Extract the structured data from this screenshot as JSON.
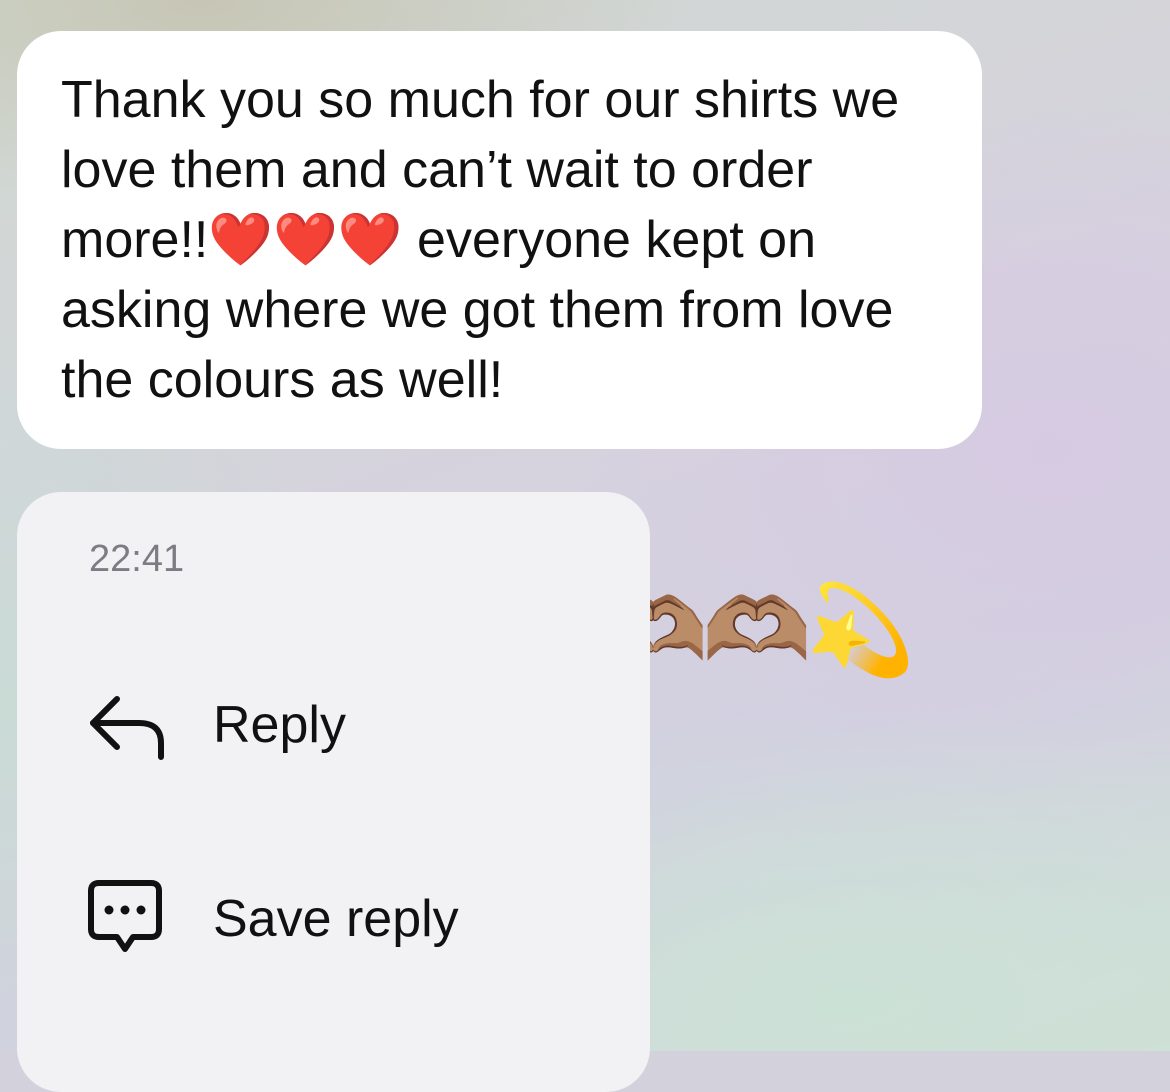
{
  "message": {
    "text": "Thank you so much for our shirts we love them and can’t wait to order more!!❤️❤️❤️ everyone kept on asking where we got them from love the colours as well!"
  },
  "reactions": {
    "emojis": "🫶🏽🫶🏽🫶🏽💫"
  },
  "menu": {
    "timestamp": "22:41",
    "items": [
      {
        "label": "Reply",
        "icon": "reply-arrow-icon"
      },
      {
        "label": "Save reply",
        "icon": "chat-bubble-dots-icon"
      }
    ]
  },
  "colors": {
    "bubble": "#ffffff",
    "menu": "#f2f2f4",
    "text": "#111111",
    "timestamp": "#7c7c84"
  }
}
